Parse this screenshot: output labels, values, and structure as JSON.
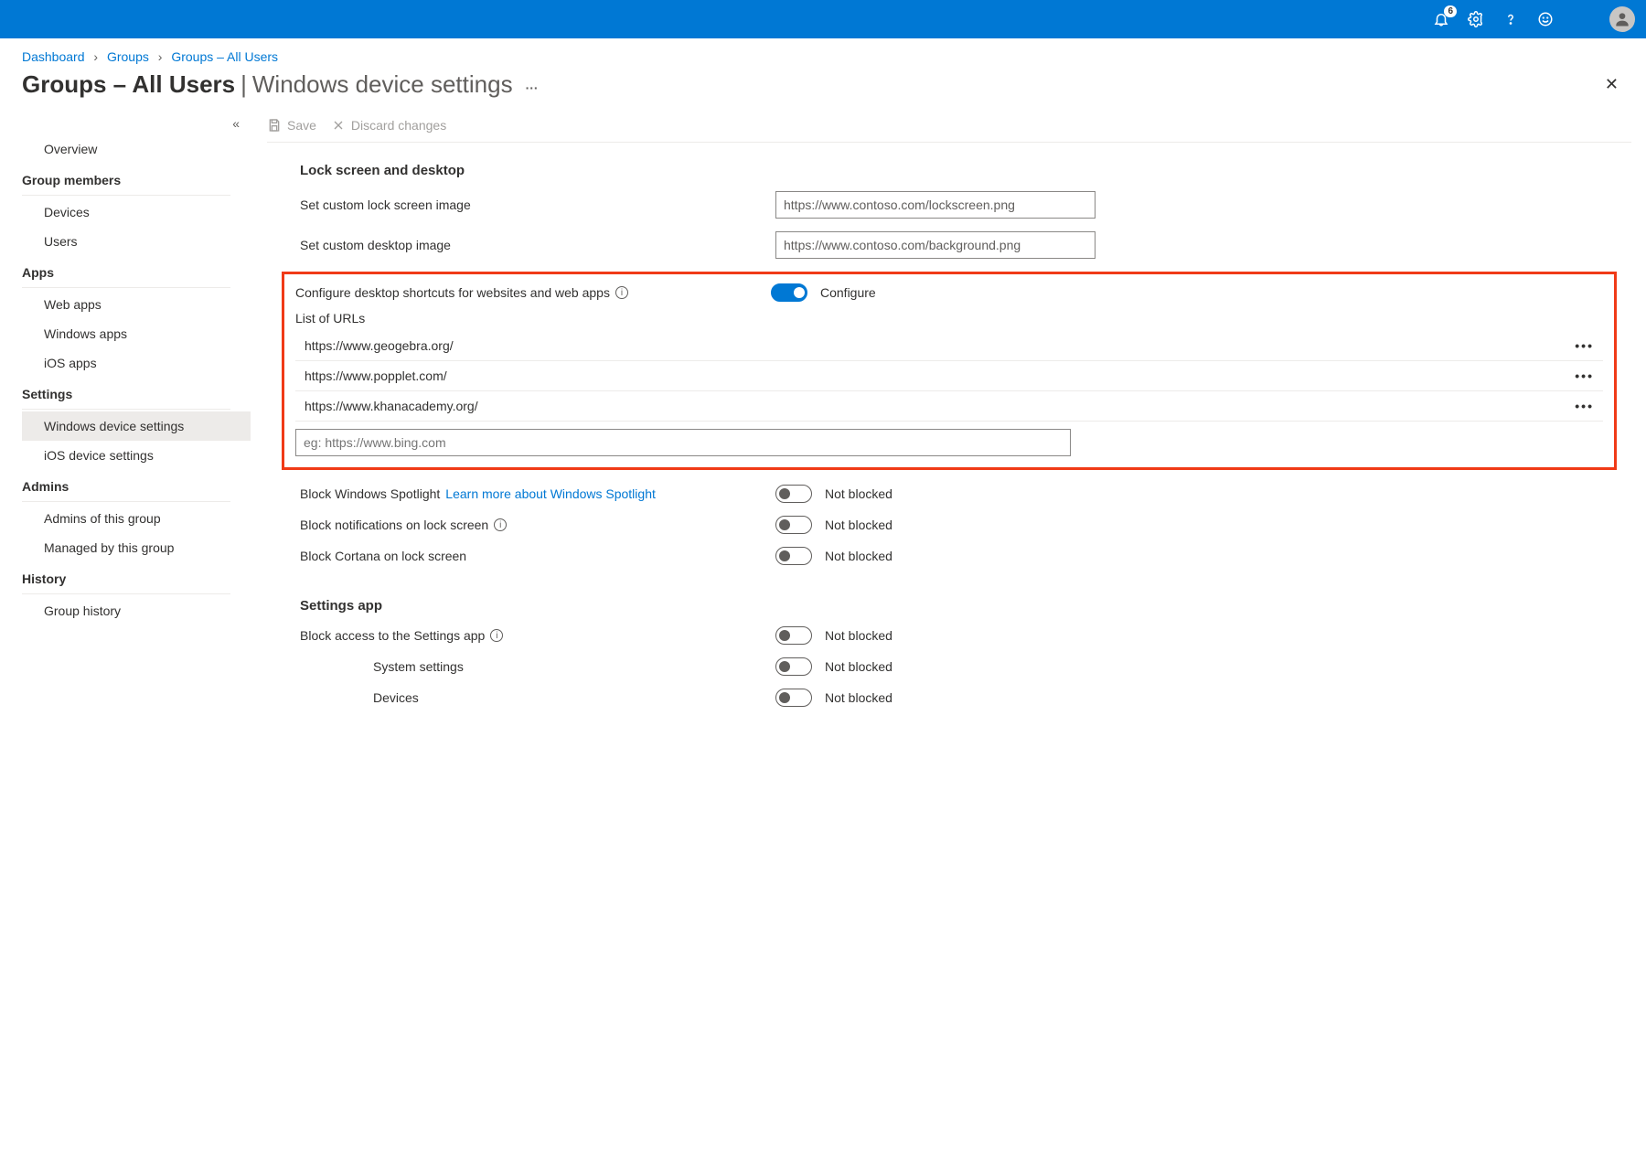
{
  "header": {
    "notification_count": "6"
  },
  "breadcrumb": {
    "items": [
      "Dashboard",
      "Groups",
      "Groups – All Users"
    ]
  },
  "page_title": {
    "main": "Groups – All Users",
    "separator": "|",
    "sub": "Windows device settings"
  },
  "commands": {
    "save": "Save",
    "discard": "Discard changes"
  },
  "sidebar": {
    "overview": "Overview",
    "sections": [
      {
        "title": "Group members",
        "items": [
          "Devices",
          "Users"
        ]
      },
      {
        "title": "Apps",
        "items": [
          "Web apps",
          "Windows apps",
          "iOS apps"
        ]
      },
      {
        "title": "Settings",
        "items": [
          "Windows device settings",
          "iOS device settings"
        ],
        "active_index": 0
      },
      {
        "title": "Admins",
        "items": [
          "Admins of this group",
          "Managed by this group"
        ]
      },
      {
        "title": "History",
        "items": [
          "Group history"
        ]
      }
    ]
  },
  "main": {
    "lock_section": {
      "heading": "Lock screen and desktop",
      "lockscreen_label": "Set custom lock screen image",
      "lockscreen_value": "https://www.contoso.com/lockscreen.png",
      "desktop_label": "Set custom desktop image",
      "desktop_value": "https://www.contoso.com/background.png",
      "shortcuts_label": "Configure desktop shortcuts for websites and web apps",
      "shortcuts_toggle_text": "Configure",
      "url_list_label": "List of URLs",
      "urls": [
        "https://www.geogebra.org/",
        "https://www.popplet.com/",
        "https://www.khanacademy.org/"
      ],
      "url_placeholder": "eg: https://www.bing.com",
      "spotlight_label": "Block Windows Spotlight",
      "spotlight_link": "Learn more about Windows Spotlight",
      "notifications_label": "Block notifications on lock screen",
      "cortana_label": "Block Cortana on lock screen",
      "not_blocked": "Not blocked"
    },
    "settings_app": {
      "heading": "Settings app",
      "block_access_label": "Block access to the Settings app",
      "system_label": "System settings",
      "devices_label": "Devices",
      "not_blocked": "Not blocked"
    }
  }
}
